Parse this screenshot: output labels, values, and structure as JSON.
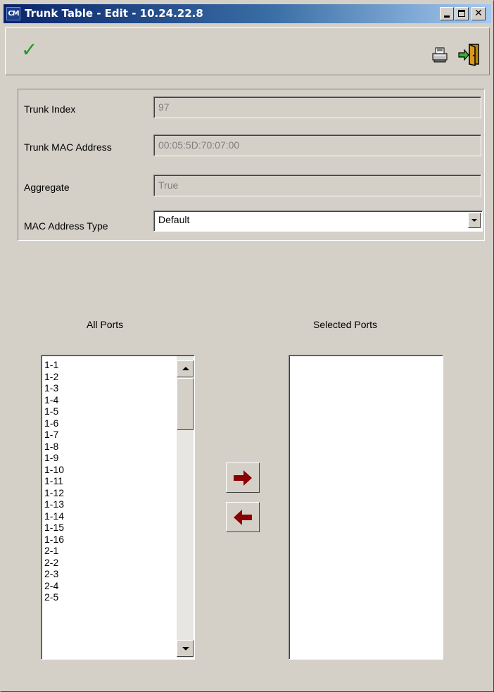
{
  "window": {
    "icon_text": "CM",
    "title": "Trunk Table - Edit - 10.24.22.8",
    "close_symbol": "✕"
  },
  "toolbar": {
    "apply_symbol": "✓",
    "icons": [
      "check-icon",
      "printer-icon",
      "exit-door-icon"
    ]
  },
  "form": {
    "trunk_index_label": "Trunk Index",
    "trunk_index_value": "97",
    "trunk_mac_label": "Trunk MAC Address",
    "trunk_mac_value": "00:05:5D:70:07:00",
    "aggregate_label": "Aggregate",
    "aggregate_value": "True",
    "mac_type_label": "MAC Address Type",
    "mac_type_value": "Default"
  },
  "ports": {
    "all_label": "All Ports",
    "selected_label": "Selected Ports",
    "all": [
      "1-1",
      "1-2",
      "1-3",
      "1-4",
      "1-5",
      "1-6",
      "1-7",
      "1-8",
      "1-9",
      "1-10",
      "1-11",
      "1-12",
      "1-13",
      "1-14",
      "1-15",
      "1-16",
      "2-1",
      "2-2",
      "2-3",
      "2-4",
      "2-5"
    ],
    "selected": []
  },
  "colors": {
    "window_bg": "#d4d0c8",
    "title_start": "#0a246a",
    "title_end": "#a6caf0",
    "arrow": "#8b0000",
    "check": "#1e9a1e"
  }
}
